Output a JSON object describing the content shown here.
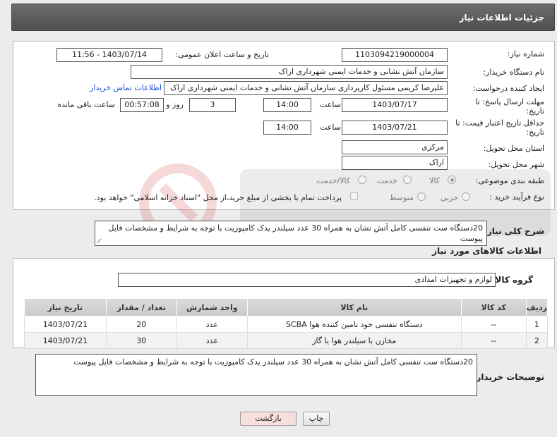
{
  "header": {
    "title": "جزئیات اطلاعات نیاز"
  },
  "fields": {
    "need_number_label": "شماره نیاز:",
    "need_number": "1103094219000004",
    "announce_label": "تاریخ و ساعت اعلان عمومی:",
    "announce_value": "1403/07/14 - 11:56",
    "buyer_org_label": "نام دستگاه خریدار:",
    "buyer_org": "سازمان آتش نشانی و خدمات ایمنی شهرداری اراک",
    "requester_label": "ایجاد کننده درخواست:",
    "requester": "علیرضا  کریمی  مسئول کارپردازی سازمان آتش نشانی و خدمات ایمنی شهرداری اراک",
    "contact_link": "اطلاعات تماس خریدار",
    "send_deadline_label": "مهلت ارسال پاسخ: تا",
    "date_label": "تاریخ:",
    "send_date": "1403/07/17",
    "time_label": "ساعت",
    "send_time": "14:00",
    "days_value": "3",
    "days_label": "روز و",
    "remaining_time": "00:57:08",
    "remaining_label": "ساعت باقی مانده",
    "min_validity_label": "حداقل تاریخ اعتبار قیمت: تا",
    "validity_date": "1403/07/21",
    "validity_time": "14:00",
    "province_label": "استان محل تحویل:",
    "province": "مرکزی",
    "city_label": "شهر محل تحویل:",
    "city": "اراک",
    "category_label": "طبقه بندی موضوعی:",
    "category_options": [
      "کالا",
      "خدمت",
      "کالا/خدمت"
    ],
    "process_label": "نوع فرآیند خرید :",
    "process_options": [
      "جزیی",
      "متوسط"
    ],
    "payment_note": "پرداخت تمام یا بخشی از مبلغ خرید،از محل \"اسناد خزانه اسلامی\" خواهد بود.",
    "summary_label": "شرح کلی نیاز:",
    "summary": "20دستگاه ست تنفسی کامل آتش نشان به همراه 30 عدد سیلندر یدک کامپوزیت با توجه به شرایط و مشخصات فایل پیوست"
  },
  "goods": {
    "section_title": "اطلاعات کالاهای مورد نیاز",
    "group_label": "گروه کالا:",
    "group_value": "لوازم و تجهیزات امدادی",
    "columns": [
      "ردیف",
      "کد کالا",
      "نام کالا",
      "واحد شمارش",
      "تعداد / مقدار",
      "تاریخ نیاز"
    ],
    "rows": [
      [
        "1",
        "--",
        "دستگاه تنفسی خود تامین کننده هوا SCBA",
        "عدد",
        "20",
        "1403/07/21"
      ],
      [
        "2",
        "--",
        "مخازن با سیلندر هوا یا گاز",
        "عدد",
        "30",
        "1403/07/21"
      ]
    ]
  },
  "buyer_notes": {
    "label": "توضیحات خریدار:",
    "text": "20دستگاه ست تنفسی کامل آتش نشان به همراه 30 عدد سیلندر یدک کامپوزیت با توجه به شرایط و مشخصات فایل پیوست"
  },
  "buttons": {
    "print": "چاپ",
    "back": "بازگشت"
  },
  "colors": {
    "link": "#1a4fd6",
    "back_bg": "#f9dede"
  }
}
